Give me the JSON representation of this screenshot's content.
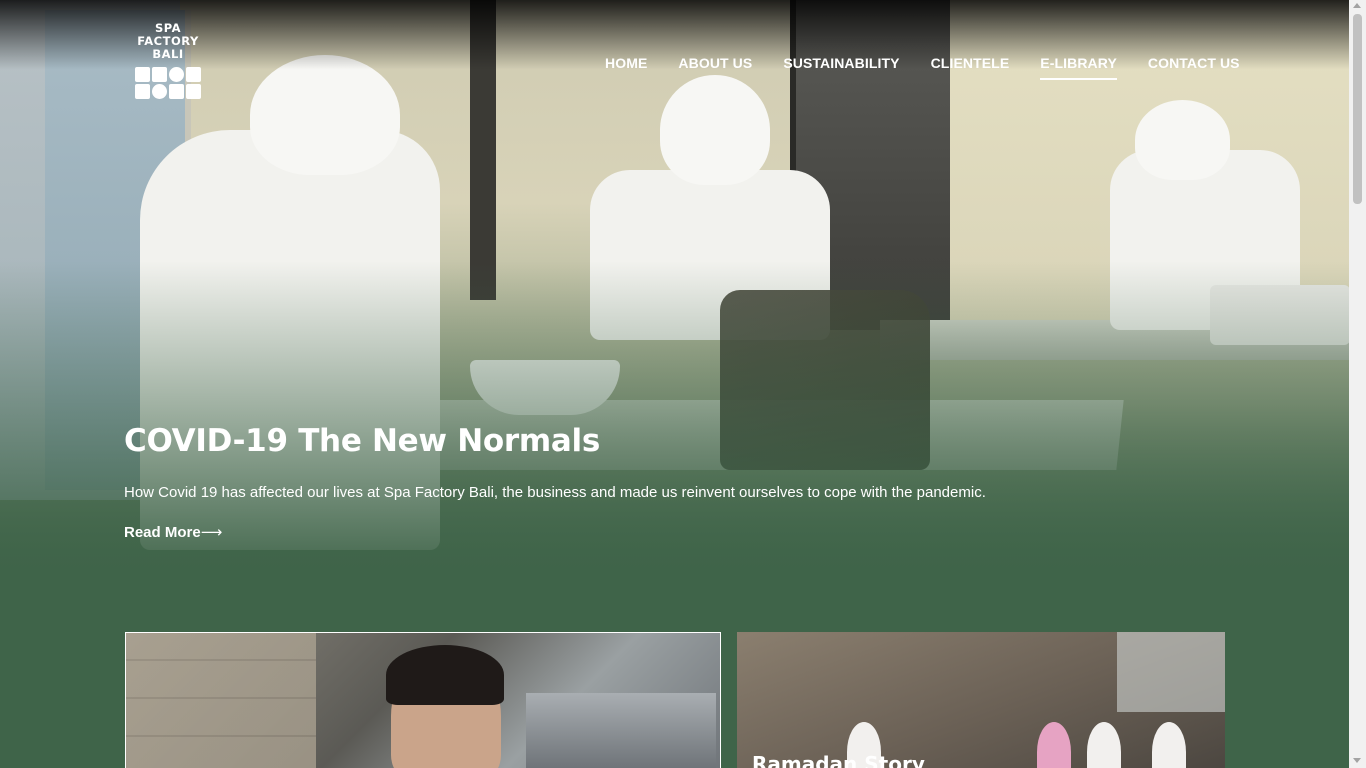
{
  "brand": {
    "logo_text": "SPA FACTORY BALI",
    "logo_lines": [
      "SPA",
      "FACTORY",
      "BALI"
    ]
  },
  "nav": {
    "items": [
      {
        "label": "HOME",
        "active": false
      },
      {
        "label": "ABOUT US",
        "active": false
      },
      {
        "label": "SUSTAINABILITY",
        "active": false
      },
      {
        "label": "CLIENTELE",
        "active": false
      },
      {
        "label": "E-LIBRARY",
        "active": true
      },
      {
        "label": "CONTACT US",
        "active": false
      }
    ]
  },
  "hero": {
    "title": "COVID-19 The New Normals",
    "description": "How Covid 19 has affected our lives at Spa Factory Bali, the business and made us reinvent ourselves to cope with the pandemic.",
    "read_more_label": "Read More",
    "read_more_arrow": "⟶"
  },
  "cards": [
    {
      "title": ""
    },
    {
      "title": "Ramadan Story"
    }
  ],
  "colors": {
    "accent_green": "#3f6449",
    "text_white": "#ffffff"
  }
}
